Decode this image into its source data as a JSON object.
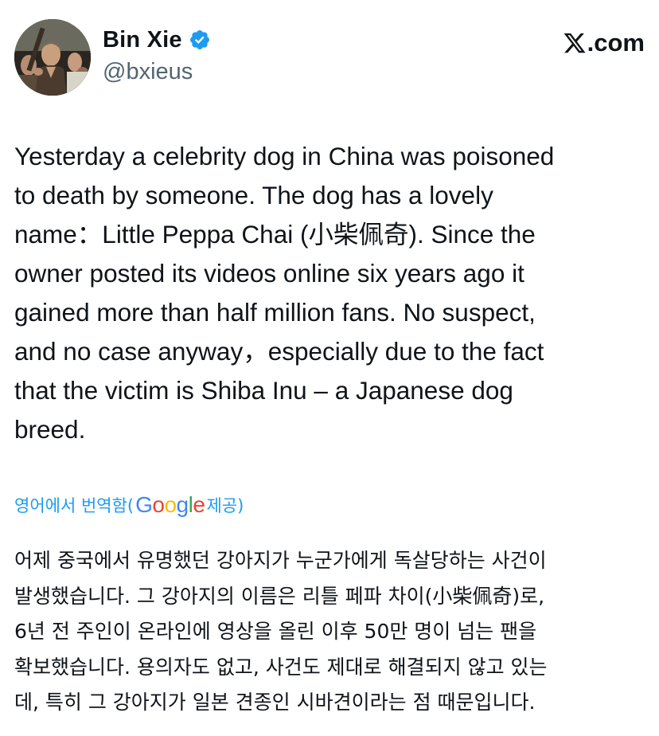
{
  "author": {
    "display_name": "Bin Xie",
    "handle": "@bxieus",
    "verified": true,
    "avatar_icon": "profile-photo"
  },
  "brand": {
    "site": ".com",
    "logo_icon": "x-logo-icon"
  },
  "tweet": {
    "text": "Yesterday a celebrity dog in China was poisoned\nto death by someone. The dog has a lovely\nname：Little Peppa Chai (小柴佩奇). Since the\nowner posted its videos online six years ago it\ngained more than half million fans. No suspect,\nand no case anyway，especially due to the fact\nthat the victim is Shiba Inu – a Japanese dog\nbreed."
  },
  "translation": {
    "prefix": "영어에서 번역함(",
    "google_letters": [
      "G",
      "o",
      "o",
      "g",
      "l",
      "e"
    ],
    "suffix": " 제공)",
    "text": "어제 중국에서 유명했던 강아지가 누군가에게 독살당하는 사건이\n발생했습니다. 그 강아지의 이름은 리틀 페파 차이(小柴佩奇)로,\n6년 전 주인이 온라인에 영상을 올린 이후 50만 명이 넘는 팬을\n확보했습니다. 용의자도 없고, 사건도 제대로 해결되지 않고 있는\n데, 특히 그 강아지가 일본 견종인 시바견이라는 점 때문입니다."
  },
  "colors": {
    "text_primary": "#0f1419",
    "text_secondary": "#536471",
    "link_blue": "#1d9bf0",
    "verified_blue": "#1d9bf0"
  }
}
